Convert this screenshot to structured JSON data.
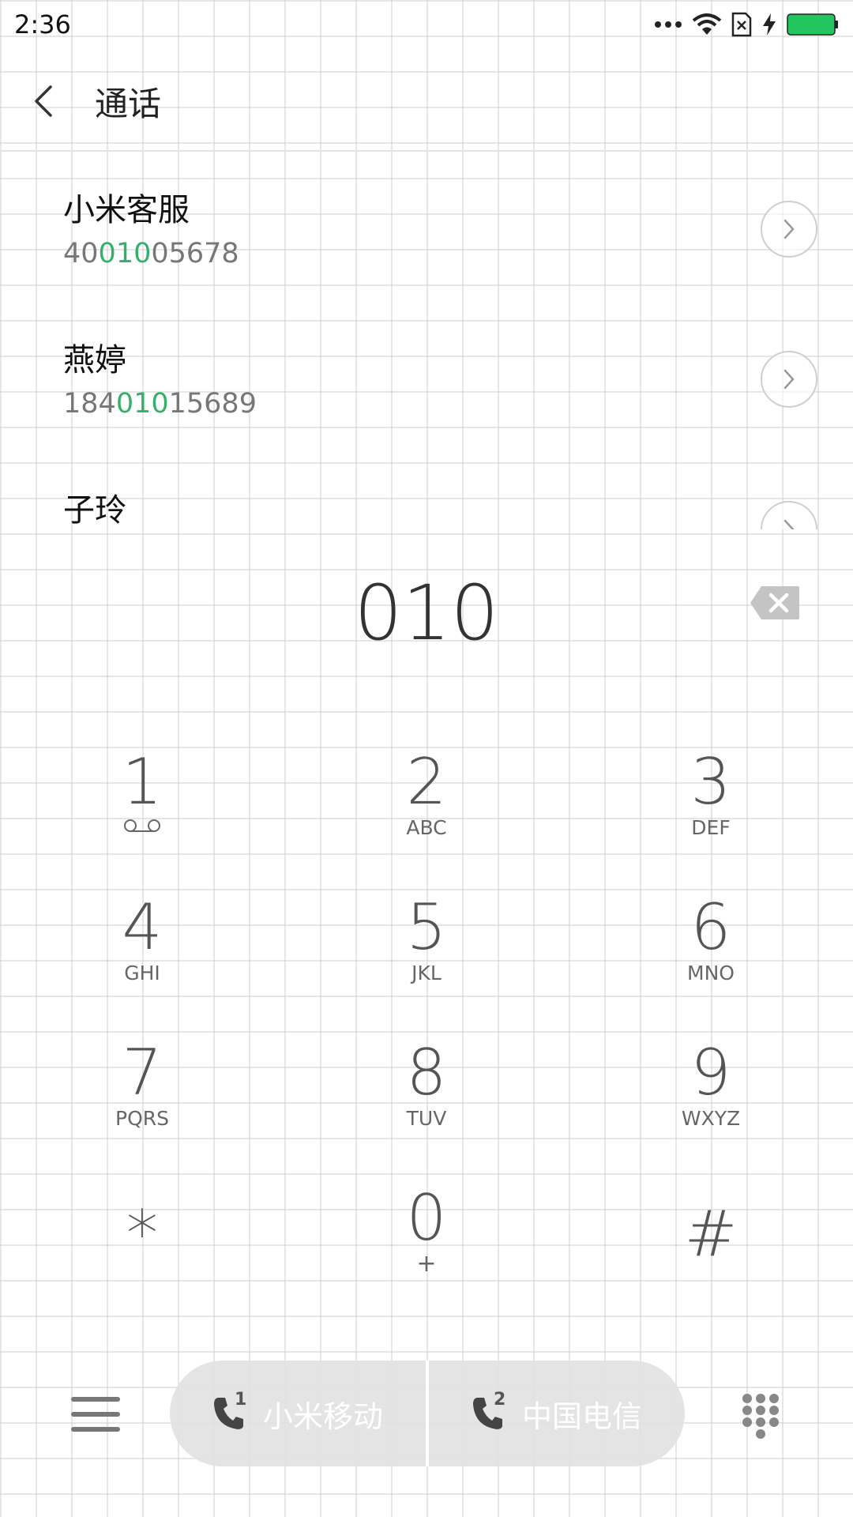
{
  "status_bar": {
    "time": "2:36",
    "icons": [
      "more-dots-icon",
      "wifi-icon",
      "no-sim-icon",
      "charging-icon",
      "battery-icon"
    ],
    "battery_color": "#22c55e"
  },
  "header": {
    "title": "通话"
  },
  "results": [
    {
      "name": "小米客服",
      "number_prefix": "40",
      "number_match": "010",
      "number_suffix": "05678"
    },
    {
      "name": "燕婷",
      "number_prefix": "184",
      "number_match": "010",
      "number_suffix": "15689"
    },
    {
      "name": "子玲",
      "number_prefix": "",
      "number_match": "",
      "number_suffix": ""
    }
  ],
  "dial": {
    "number": "010"
  },
  "keys": [
    {
      "digit": "1",
      "letters": ""
    },
    {
      "digit": "2",
      "letters": "ABC"
    },
    {
      "digit": "3",
      "letters": "DEF"
    },
    {
      "digit": "4",
      "letters": "GHI"
    },
    {
      "digit": "5",
      "letters": "JKL"
    },
    {
      "digit": "6",
      "letters": "MNO"
    },
    {
      "digit": "7",
      "letters": "PQRS"
    },
    {
      "digit": "8",
      "letters": "TUV"
    },
    {
      "digit": "9",
      "letters": "WXYZ"
    },
    {
      "digit": "*",
      "letters": ""
    },
    {
      "digit": "0",
      "letters": "+"
    },
    {
      "digit": "#",
      "letters": ""
    }
  ],
  "bottom_bar": {
    "sim1_label": "小米移动",
    "sim1_index": "1",
    "sim2_label": "中国电信",
    "sim2_index": "2"
  },
  "colors": {
    "match_highlight": "#35b06a",
    "text_primary": "#111111",
    "text_secondary": "#777777"
  }
}
